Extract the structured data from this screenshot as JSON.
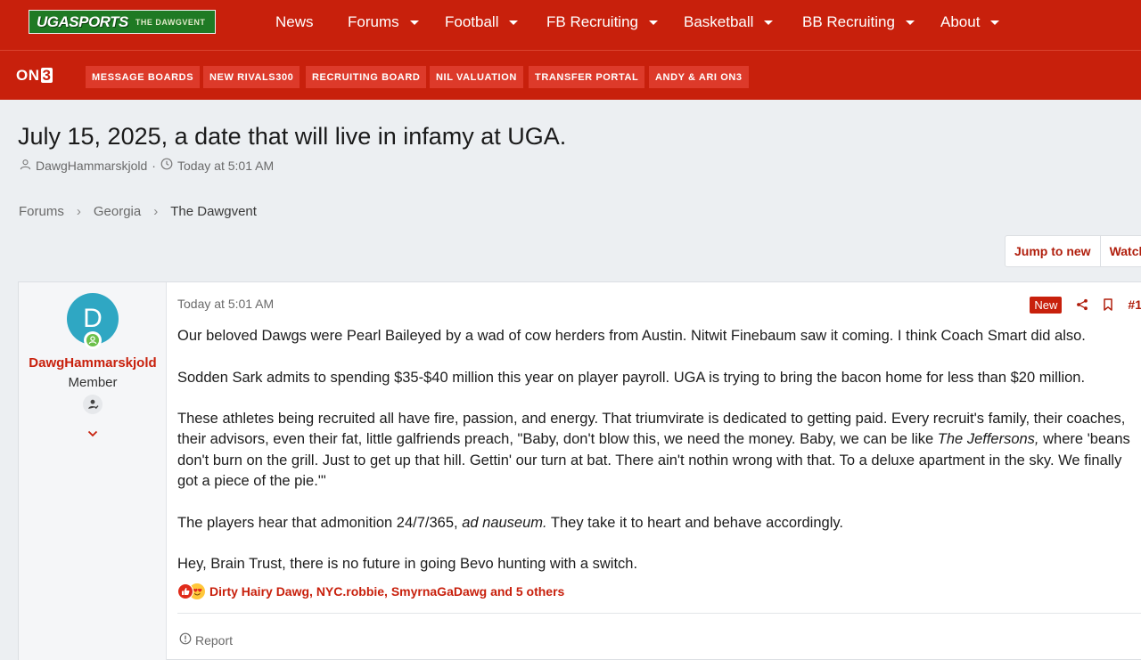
{
  "header": {
    "logo_main": "UGASPORTS",
    "logo_sub": "THE DAWGVENT",
    "nav": [
      {
        "label": "News",
        "has_dropdown": false
      },
      {
        "label": "Forums",
        "has_dropdown": true
      },
      {
        "label": "Football",
        "has_dropdown": true
      },
      {
        "label": "FB Recruiting",
        "has_dropdown": true
      },
      {
        "label": "Basketball",
        "has_dropdown": true
      },
      {
        "label": "BB Recruiting",
        "has_dropdown": true
      },
      {
        "label": "About",
        "has_dropdown": true
      }
    ]
  },
  "subnav": {
    "brand": "ON",
    "brand_mark": "3",
    "items": [
      "MESSAGE BOARDS",
      "NEW RIVALS300",
      "RECRUITING BOARD",
      "NIL VALUATION",
      "TRANSFER PORTAL",
      "ANDY & ARI ON3"
    ]
  },
  "thread": {
    "title": "July 15, 2025, a date that will live in infamy at UGA.",
    "author": "DawgHammarskjold",
    "separator": "·",
    "time": "Today at 5:01 AM"
  },
  "breadcrumb": [
    "Forums",
    "Georgia",
    "The Dawgvent"
  ],
  "thread_actions": {
    "jump_label": "Jump to new",
    "watch_label": "Watch"
  },
  "post": {
    "user": {
      "avatar_letter": "D",
      "name": "DawgHammarskjold",
      "title": "Member"
    },
    "date": "Today at 5:01 AM",
    "new_badge": "New",
    "number": "#1",
    "paragraphs": {
      "p1": "Our beloved Dawgs were Pearl Baileyed by a wad of cow herders from Austin. Nitwit Finebaum saw it coming. I think Coach Smart did also.",
      "p2": "Sodden Sark admits to spending $35-$40 million this year on player payroll. UGA is trying to bring the bacon home for less than $20 million.",
      "p3_before": "These athletes being recruited all have fire, passion, and energy. That triumvirate is dedicated to getting paid. Every recruit's family, their coaches, their advisors, even their fat, little galfriends preach, \"Baby, don't blow this, we need the money. Baby, we can be like ",
      "p3_italic": "The Jeffersons,",
      "p3_after": " where 'beans don't burn on the grill. Just to get up that hill. Gettin' our turn at bat. There ain't nothin wrong with that. To a deluxe apartment in the sky. We finally got a piece of the pie.'\"",
      "p4_before": "The players hear that admonition 24/7/365, ",
      "p4_italic": "ad nauseum.",
      "p4_after": " They take it to heart and behave accordingly.",
      "p5": "Hey, Brain Trust, there is no future in going Bevo hunting with a switch."
    },
    "reactions_text": "Dirty Hairy Dawg, NYC.robbie, SmyrnaGaDawg and 5 others",
    "report_label": "Report"
  },
  "colors": {
    "brand_red": "#c8200c",
    "subnav_button": "#dd3a2a",
    "link_red": "#b01e0c",
    "avatar_teal": "#2fa7c3",
    "logo_green": "#1f7a24",
    "page_bg": "#eceff2"
  },
  "icons": {
    "author": "user-icon",
    "time": "clock-icon",
    "share": "share-icon",
    "bookmark": "bookmark-icon",
    "report": "alert-circle-icon",
    "online": "online-status-icon",
    "expand": "chevron-down-icon"
  }
}
